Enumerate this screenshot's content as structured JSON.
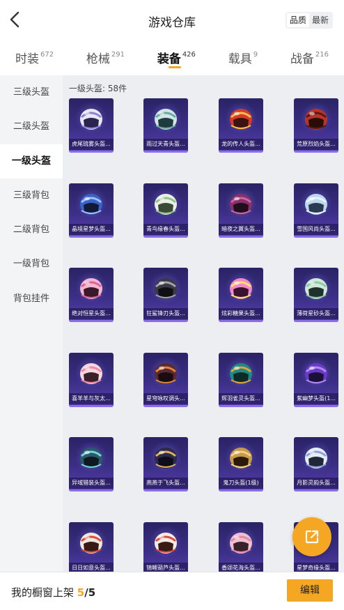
{
  "header": {
    "title": "游戏仓库",
    "sort_options": [
      {
        "label": "品质",
        "active": true
      },
      {
        "label": "最新",
        "active": false
      }
    ]
  },
  "tabs": [
    {
      "label": "时装",
      "count": "672",
      "active": false
    },
    {
      "label": "枪械",
      "count": "291",
      "active": false
    },
    {
      "label": "装备",
      "count": "426",
      "active": true
    },
    {
      "label": "载具",
      "count": "9",
      "active": false
    },
    {
      "label": "战备",
      "count": "216",
      "active": false
    }
  ],
  "sidebar": {
    "items": [
      {
        "label": "三级头盔",
        "active": false
      },
      {
        "label": "二级头盔",
        "active": false
      },
      {
        "label": "一级头盔",
        "active": true
      },
      {
        "label": "三级背包",
        "active": false
      },
      {
        "label": "二级背包",
        "active": false
      },
      {
        "label": "一级背包",
        "active": false
      },
      {
        "label": "背包挂件",
        "active": false
      }
    ]
  },
  "section": {
    "title": "一级头盔: 58件"
  },
  "items": [
    {
      "name": "虎尾琉雾头盔...",
      "shell": "#e8e8f0",
      "accent": "#8e7fd8",
      "visor": "#2b2450"
    },
    {
      "name": "雨过天青头盔...",
      "shell": "#cfe6e4",
      "accent": "#6aa7a5",
      "visor": "#1e3b40"
    },
    {
      "name": "龙的传人头盔...",
      "shell": "#d83a2a",
      "accent": "#f2c14e",
      "visor": "#3a1410"
    },
    {
      "name": "荒原烈焰头盔...",
      "shell": "#b73528",
      "accent": "#5a1812",
      "visor": "#2a0c08"
    },
    {
      "name": "晶境星梦头盔...",
      "shell": "#3a63c8",
      "accent": "#9cc2ff",
      "visor": "#121a38"
    },
    {
      "name": "青鸟缘春头盔...",
      "shell": "#e9efe6",
      "accent": "#8fc48a",
      "visor": "#3a4a34"
    },
    {
      "name": "暗夜之翼头盔...",
      "shell": "#8a2f6a",
      "accent": "#c76aa4",
      "visor": "#1f0e1b"
    },
    {
      "name": "雪国风尚头盔...",
      "shell": "#bcd8f0",
      "accent": "#e8f3ff",
      "visor": "#2a3a52"
    },
    {
      "name": "绝对恒星头盔...",
      "shell": "#f2b7cf",
      "accent": "#e0609a",
      "visor": "#3a1a2a"
    },
    {
      "name": "狂鲨锋刃头盔...",
      "shell": "#3a3a44",
      "accent": "#a0a4b0",
      "visor": "#101014"
    },
    {
      "name": "炫彩糖果头盔...",
      "shell": "#f08ac4",
      "accent": "#ffe06a",
      "visor": "#3a1230"
    },
    {
      "name": "薄荷星砂头盔...",
      "shell": "#cfe8d8",
      "accent": "#8cc9a8",
      "visor": "#20302a"
    },
    {
      "name": "喜羊羊与灰太...",
      "shell": "#f7d6e0",
      "accent": "#f08aa8",
      "visor": "#3a2028"
    },
    {
      "name": "星穹咏叹调头...",
      "shell": "#5a2a30",
      "accent": "#e0863a",
      "visor": "#1a0c10"
    },
    {
      "name": "辉羽雀灵头盔...",
      "shell": "#1e8a86",
      "accent": "#e0a23a",
      "visor": "#0e2a28"
    },
    {
      "name": "紫幽梦头盔(1...",
      "shell": "#6a3ac8",
      "accent": "#b08af0",
      "visor": "#1a1038"
    },
    {
      "name": "异域猎装头盔...",
      "shell": "#2a5a6a",
      "accent": "#7ad0e0",
      "visor": "#0e1a20"
    },
    {
      "name": "燕燕于飞头盔...",
      "shell": "#2a2a4a",
      "accent": "#e0b05a",
      "visor": "#0e0e1a"
    },
    {
      "name": "鬼刀头盔(1级)",
      "shell": "#c89a4a",
      "accent": "#f2d08a",
      "visor": "#2a1a0a"
    },
    {
      "name": "月影灵韵头盔...",
      "shell": "#e6ecf5",
      "accent": "#8aa2d8",
      "visor": "#202838"
    },
    {
      "name": "日日如意头盔...",
      "shell": "#f0e8e0",
      "accent": "#d8503a",
      "visor": "#3a1a14"
    },
    {
      "name": "锦鲤葫芦头盔...",
      "shell": "#f2ece6",
      "accent": "#e04a3a",
      "visor": "#3a1a14"
    },
    {
      "name": "香颂花海头盔...",
      "shell": "#f0c0d0",
      "accent": "#e08aa8",
      "visor": "#3a2028"
    },
    {
      "name": "星梦奇缘头盔...",
      "shell": "#9a8ad8",
      "accent": "#d8c8ff",
      "visor": "#1a1438"
    }
  ],
  "bottom": {
    "showcase_label": "我的橱窗上架",
    "showcase_current": "5",
    "showcase_total": "/5",
    "edit_label": "编辑"
  },
  "colors": {
    "accent": "#f5a623",
    "card_bg": "#3b2f86"
  },
  "icons": {
    "back": "chevron-left-icon",
    "share": "share-external-icon"
  }
}
